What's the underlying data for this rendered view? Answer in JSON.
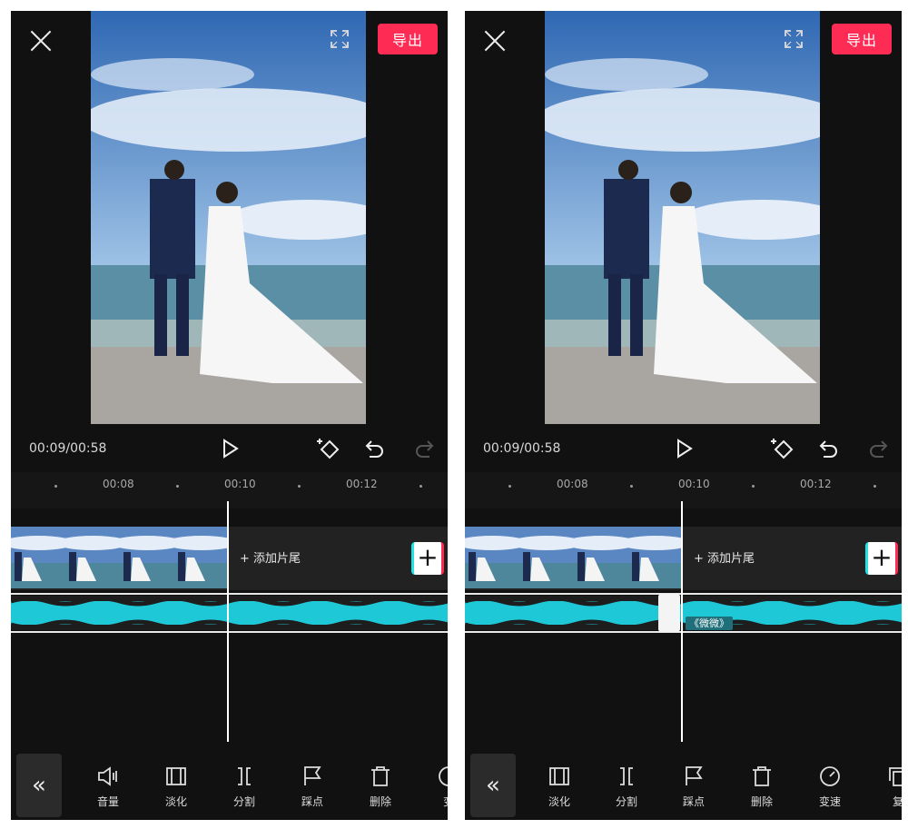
{
  "screens": {
    "left": {
      "top_bar": {
        "export_label": "导出"
      },
      "playback": {
        "time": "00:09/00:58"
      },
      "ruler": {
        "ticks": [
          "00:08",
          "00:10",
          "00:12"
        ]
      },
      "video_track": {
        "add_ending_label": "添加片尾",
        "add_clip_symbol": "+"
      },
      "toolbar": {
        "collapse_symbol": "«",
        "items": [
          {
            "label": "音量",
            "icon": "volume-icon"
          },
          {
            "label": "淡化",
            "icon": "fade-icon"
          },
          {
            "label": "分割",
            "icon": "split-icon"
          },
          {
            "label": "踩点",
            "icon": "beat-flag-icon"
          },
          {
            "label": "删除",
            "icon": "delete-icon"
          },
          {
            "label": "变",
            "icon": "speed-icon"
          }
        ]
      }
    },
    "right": {
      "top_bar": {
        "export_label": "导出"
      },
      "playback": {
        "time": "00:09/00:58"
      },
      "ruler": {
        "ticks": [
          "00:08",
          "00:10",
          "00:12"
        ]
      },
      "video_track": {
        "add_ending_label": "添加片尾",
        "add_clip_symbol": "+"
      },
      "audio_track": {
        "fade_label": "《微微》"
      },
      "toolbar": {
        "collapse_symbol": "«",
        "items": [
          {
            "label": "淡化",
            "icon": "fade-icon"
          },
          {
            "label": "分割",
            "icon": "split-icon"
          },
          {
            "label": "踩点",
            "icon": "beat-flag-icon"
          },
          {
            "label": "删除",
            "icon": "delete-icon"
          },
          {
            "label": "变速",
            "icon": "speed-icon"
          },
          {
            "label": "复",
            "icon": "copy-icon"
          }
        ]
      }
    }
  },
  "colors": {
    "accent": "#fe2c55",
    "waveform": "#1ec8d6",
    "background": "#111111"
  }
}
